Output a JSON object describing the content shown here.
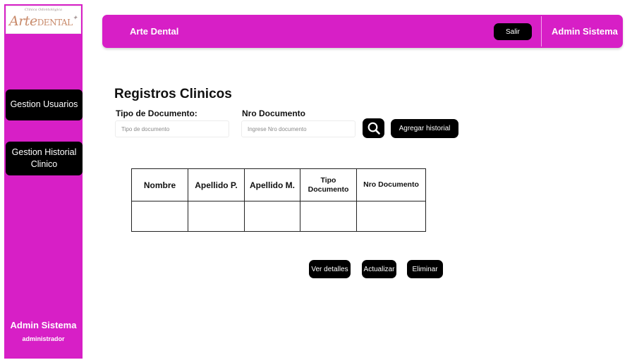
{
  "logo": {
    "small": "Clínica Odontológica",
    "main": "Arte",
    "dental": "DENTAL"
  },
  "sidebar": {
    "items": [
      {
        "label": "Gestion Usuarios"
      },
      {
        "label_line1": "Gestion Historial",
        "label_line2": "Clinico"
      }
    ],
    "user": {
      "name": "Admin Sistema",
      "role": "administrador"
    }
  },
  "header": {
    "title": "Arte Dental",
    "logout_label": "Salir",
    "user": "Admin Sistema"
  },
  "main": {
    "title": "Registros Clinicos",
    "doc_type_label": "Tipo de Documento:",
    "doc_type_placeholder": "Tipo de documento",
    "doc_number_label": "Nro Documento",
    "doc_number_placeholder": "Ingrese Nro documento",
    "add_button": "Agregar  historial",
    "table": {
      "headers": [
        "Nombre",
        "Apellido P.",
        "Apellido M.",
        "Tipo Documento",
        "Nro Documento"
      ],
      "header4_line1": "Tipo",
      "header4_line2": "Documento"
    },
    "actions": {
      "details": "Ver detalles",
      "update": "Actualizar",
      "delete": "Eliminar"
    }
  },
  "colors": {
    "accent": "#d71fc6",
    "button": "#000000"
  }
}
